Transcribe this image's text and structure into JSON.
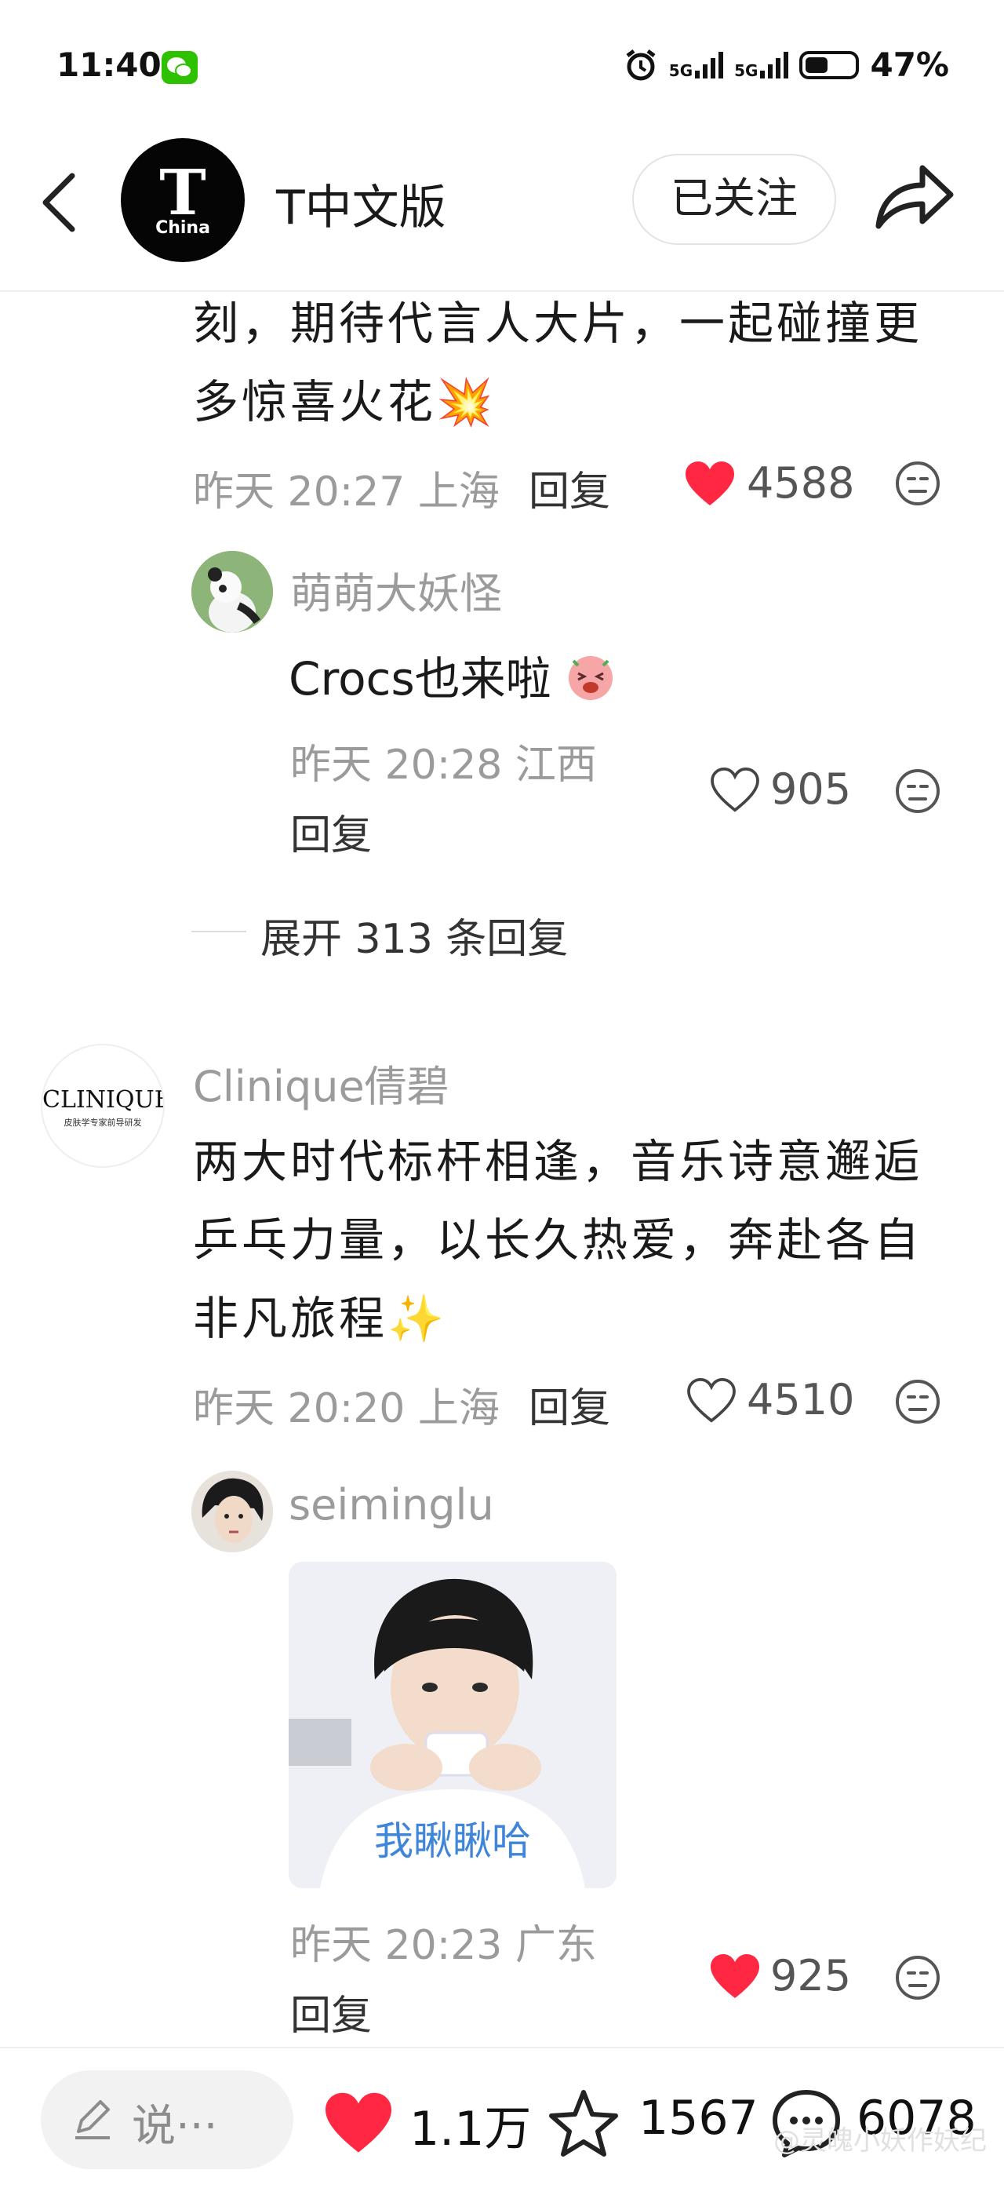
{
  "status_bar": {
    "time": "11:40",
    "signal_1": "5G",
    "signal_2": "5G",
    "battery_level": 0.47,
    "battery": "47%"
  },
  "header": {
    "account_logo_text": "T",
    "account_logo_sub": "China",
    "account_name": "T中文版",
    "follow_label": "已关注"
  },
  "comments": [
    {
      "text_lines": [
        "刻，期待代言人大片，一起碰撞更",
        "多惊喜火花💥"
      ],
      "time": "昨天 20:27",
      "location": "上海",
      "reply_label": "回复",
      "likes": "4588",
      "liked": true,
      "replies": [
        {
          "username": "萌萌大妖怪",
          "text": "Crocs也来啦",
          "time": "昨天 20:28",
          "location": "江西",
          "reply_label": "回复",
          "likes": "905",
          "liked": false
        }
      ],
      "expand_label": "展开 313 条回复"
    },
    {
      "username": "Clinique倩碧",
      "avatar_text": "CLINIQUE",
      "avatar_sub": "皮肤学专家前导研发",
      "text_lines": [
        "两大时代标杆相逢，音乐诗意邂逅",
        "乒乓力量，以长久热爱，奔赴各自",
        "非凡旅程✨"
      ],
      "time": "昨天 20:20",
      "location": "上海",
      "reply_label": "回复",
      "likes": "4510",
      "liked": false,
      "replies": [
        {
          "username": "seiminglu",
          "image_caption": "我瞅瞅哈",
          "time": "昨天 20:23",
          "location": "广东",
          "reply_label": "回复",
          "likes": "925",
          "liked": true
        }
      ]
    }
  ],
  "bottom_bar": {
    "input_placeholder": "说···",
    "likes": "1.1万",
    "favorites": "1567",
    "comments": "6078"
  },
  "watermark": "@灵魄小妖作妖纪",
  "colors": {
    "like_red": "#ff2742",
    "meta_gray": "#9b9b9b"
  }
}
